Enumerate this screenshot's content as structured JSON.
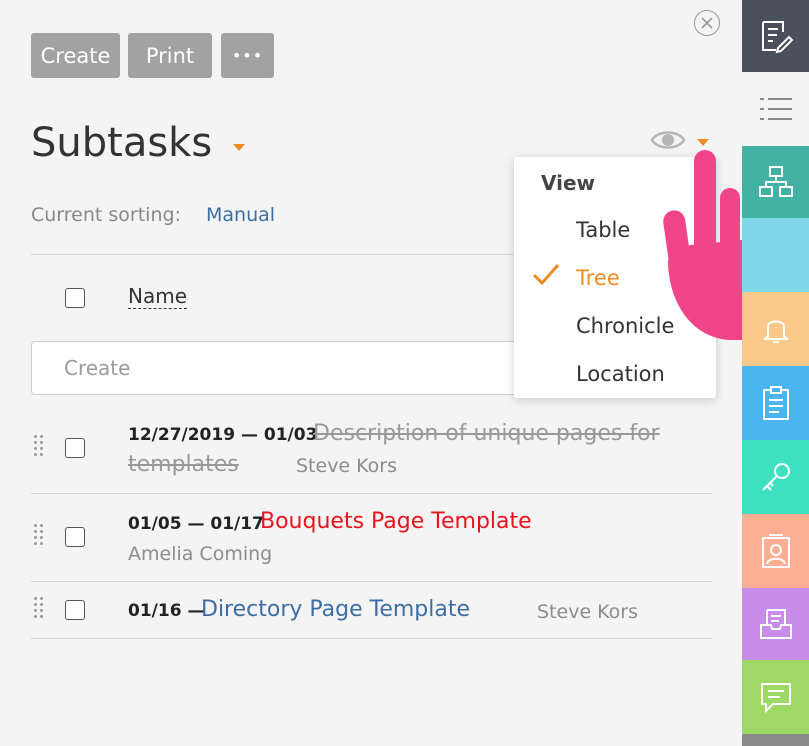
{
  "toolbar": {
    "create_label": "Create",
    "print_label": "Print",
    "more_label": "•••"
  },
  "page": {
    "title": "Subtasks"
  },
  "sorting": {
    "label": "Current sorting:",
    "value": "Manual"
  },
  "table": {
    "name_header": "Name",
    "create_placeholder": "Create"
  },
  "tasks": [
    {
      "dates": "12/27/2019 — 01/03",
      "title_line1": "Description of unique pages for",
      "title_line2": "templates",
      "assignee": "Steve Kors",
      "status": "completed"
    },
    {
      "dates": "01/05 — 01/17",
      "title": "Bouquets Page Template",
      "assignee": "Amelia Coming",
      "status": "overdue",
      "color": "#e8141c"
    },
    {
      "dates": "01/16 —",
      "title": "Directory Page Template",
      "assignee": "Steve Kors",
      "status": "active",
      "color": "#3d6ea3"
    }
  ],
  "view_menu": {
    "header": "View",
    "items": [
      "Table",
      "Tree",
      "Chronicle",
      "Location"
    ],
    "selected": "Tree"
  },
  "colors": {
    "accent": "#f08a24",
    "link": "#3d6ea3",
    "overdue": "#e8141c",
    "pointer": "#f0458a"
  },
  "sidebar": [
    {
      "icon": "edit-note-icon",
      "color": "#4a4f5c"
    },
    {
      "icon": "list-icon",
      "color": "#f4f4f4"
    },
    {
      "icon": "hierarchy-icon",
      "color": "#43b2a5"
    },
    {
      "icon": "bell-icon",
      "color": "#f9c98a"
    },
    {
      "icon": "clipboard-icon",
      "color": "#4bb5ef"
    },
    {
      "icon": "key-icon",
      "color": "#3de0c0"
    },
    {
      "icon": "contact-icon",
      "color": "#fbae92"
    },
    {
      "icon": "inbox-icon",
      "color": "#c88de8"
    },
    {
      "icon": "chat-icon",
      "color": "#9ed966"
    }
  ]
}
